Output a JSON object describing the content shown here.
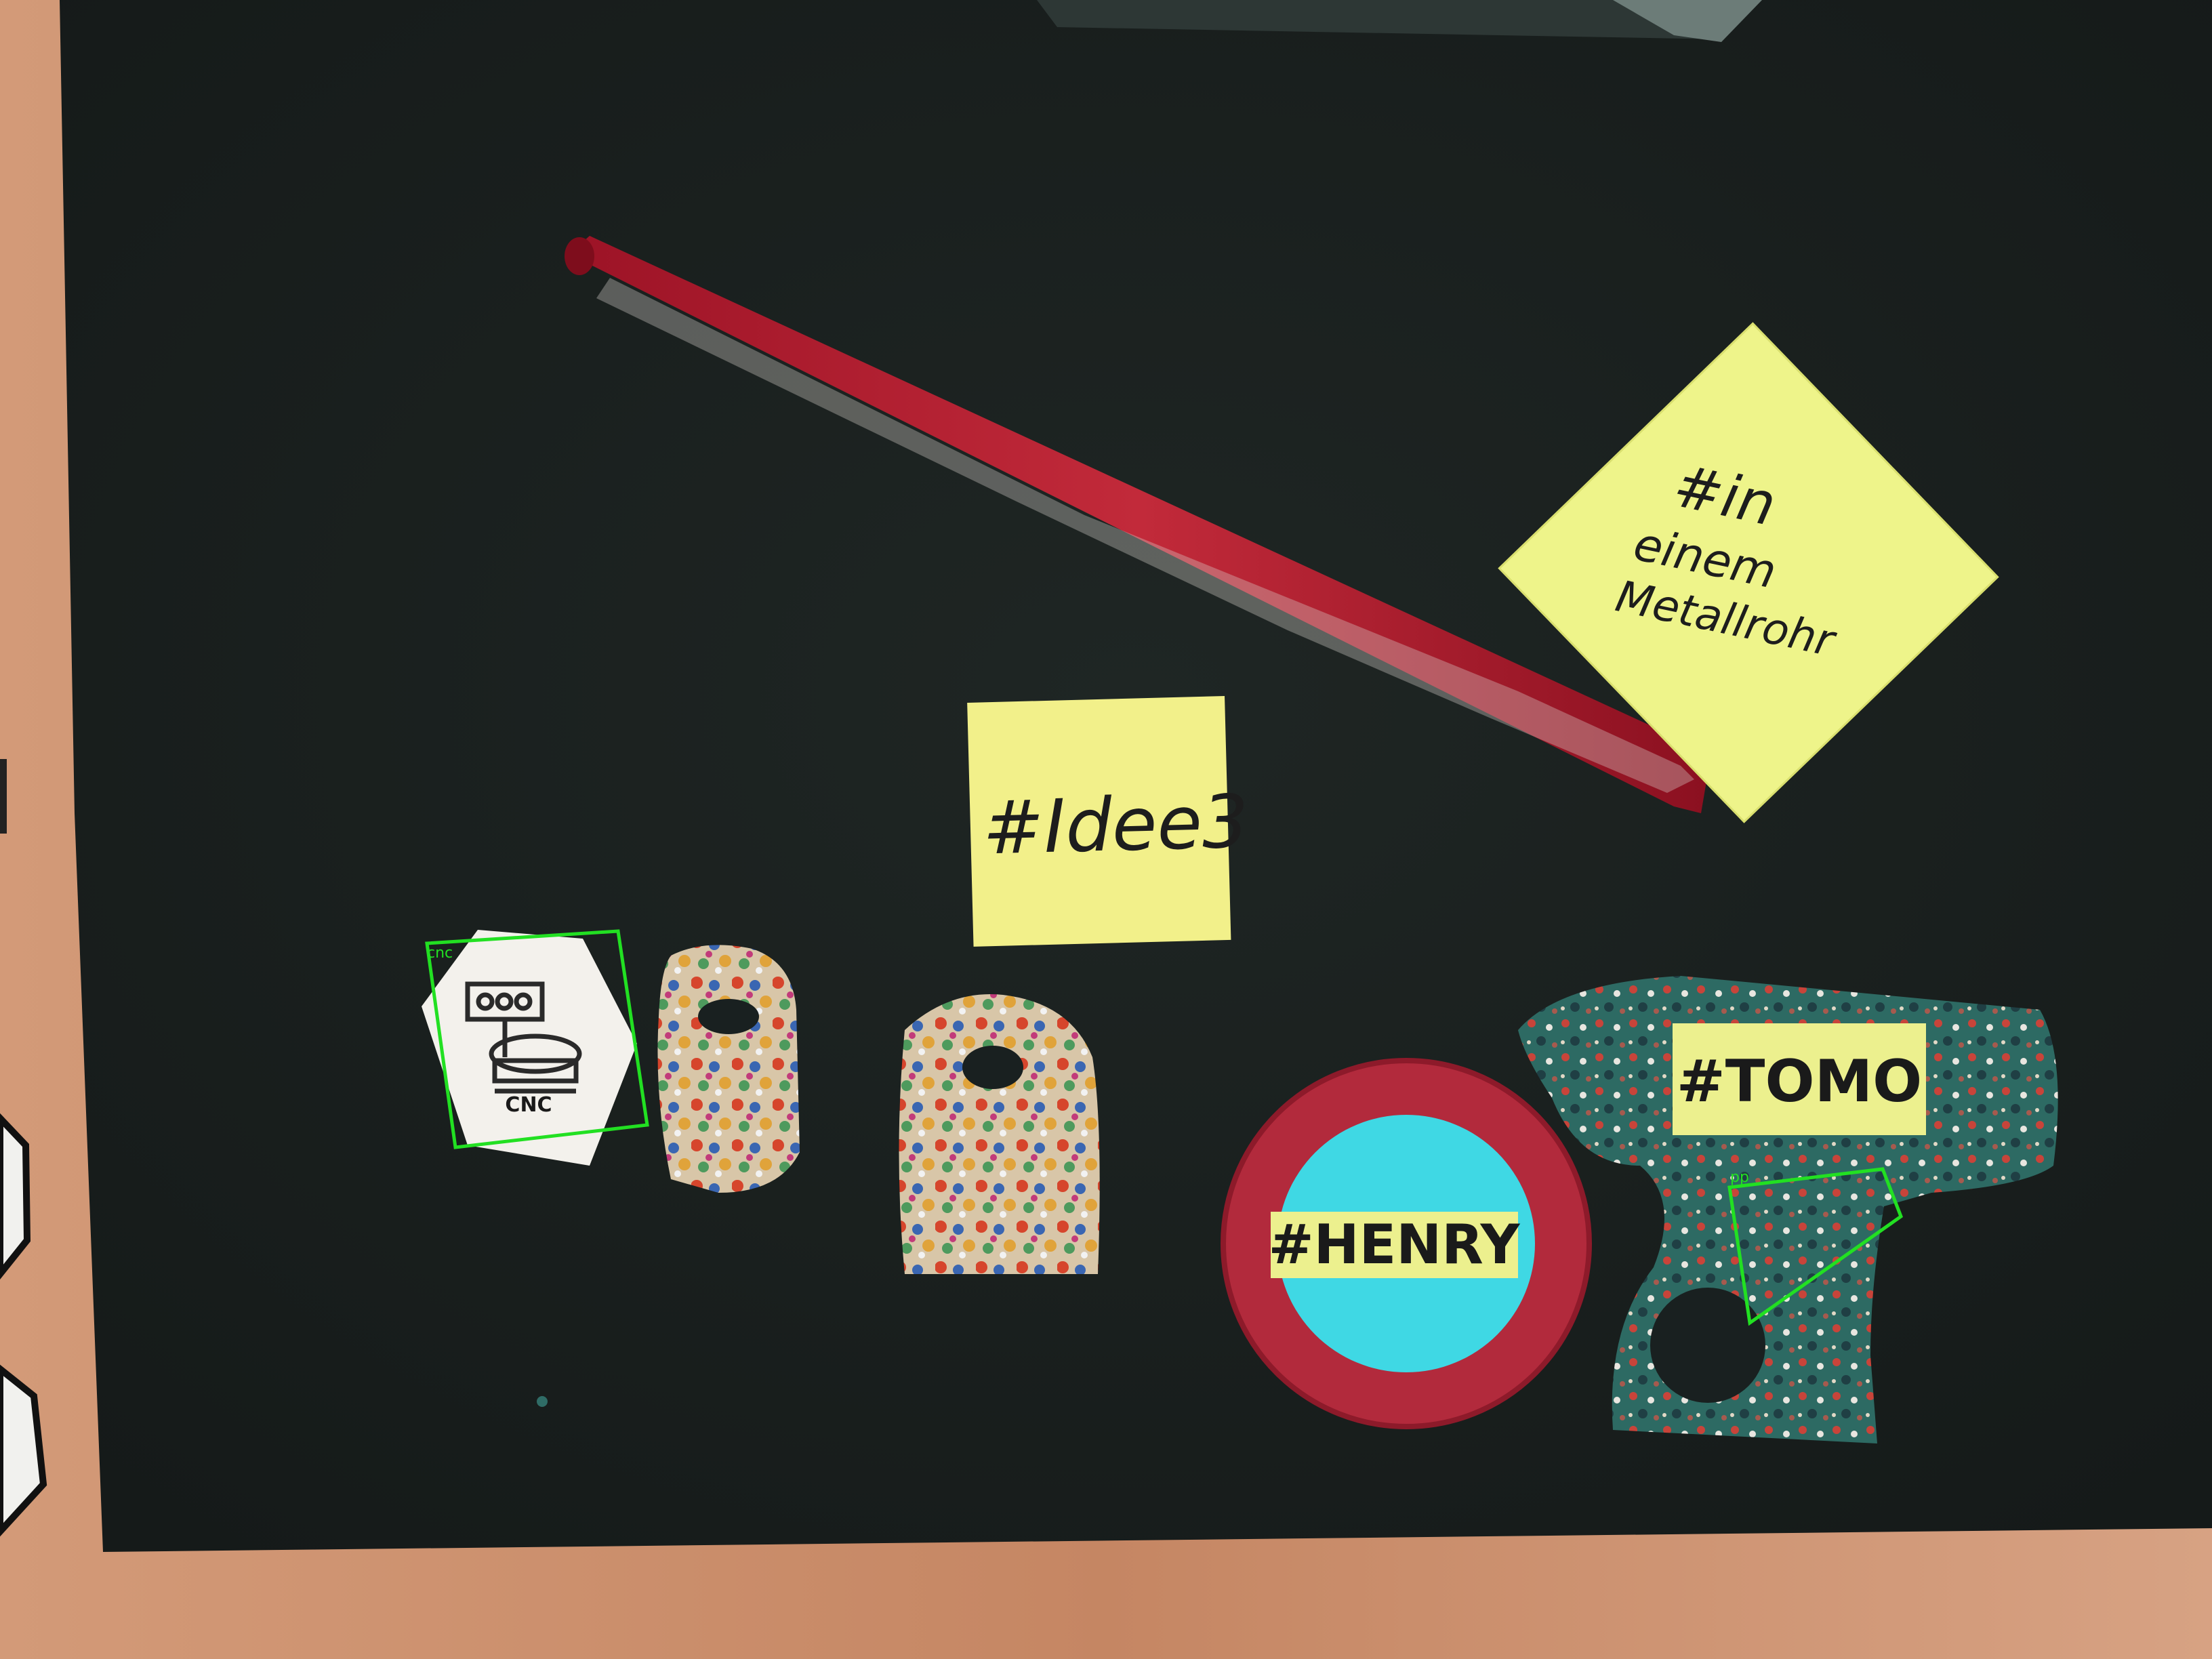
{
  "notes": {
    "idee": "#Idee3",
    "metall_line1": "#in",
    "metall_line2": "einem",
    "metall_line3": "Metallrohr"
  },
  "labels": {
    "henry": "#HENRY",
    "tomo": "#TOMO",
    "tile_text": "CNC"
  },
  "detections": [
    {
      "label": "cnc",
      "color": "#22e022"
    },
    {
      "label": "pp",
      "color": "#22e022"
    }
  ]
}
